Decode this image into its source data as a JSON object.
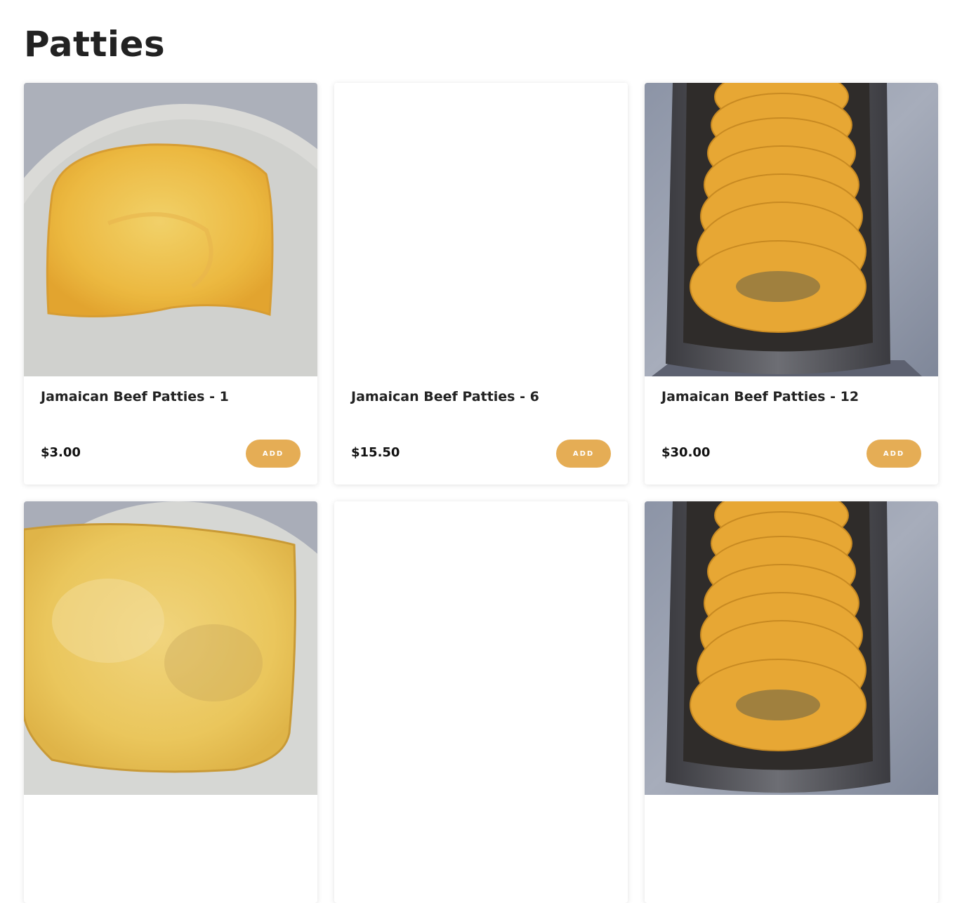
{
  "page_title": "Patties",
  "accent_color": "#e5ad55",
  "products": [
    {
      "name": "Jamaican Beef Patties - 1",
      "price": "$3.00",
      "button": "ADD",
      "image": "single-patty-photo"
    },
    {
      "name": "Jamaican Beef Patties - 6",
      "price": "$15.50",
      "button": "ADD",
      "image": "blank-image"
    },
    {
      "name": "Jamaican Beef Patties - 12",
      "price": "$30.00",
      "button": "ADD",
      "image": "patty-tray-photo"
    },
    {
      "image": "single-patty-photo-alt"
    },
    {
      "image": "blank-image"
    },
    {
      "image": "patty-tray-photo"
    }
  ]
}
